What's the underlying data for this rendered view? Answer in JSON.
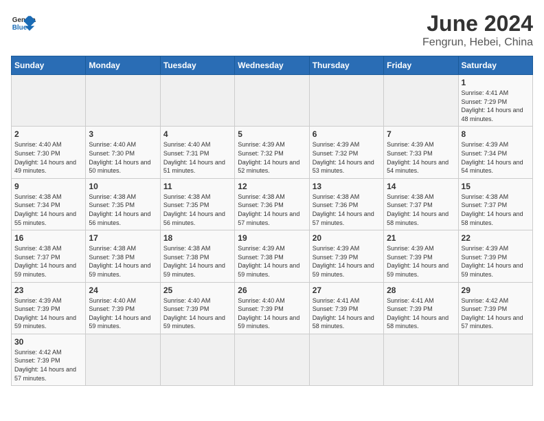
{
  "header": {
    "logo_general": "General",
    "logo_blue": "Blue",
    "month_title": "June 2024",
    "subtitle": "Fengrun, Hebei, China"
  },
  "weekdays": [
    "Sunday",
    "Monday",
    "Tuesday",
    "Wednesday",
    "Thursday",
    "Friday",
    "Saturday"
  ],
  "days": [
    {
      "day": "",
      "info": ""
    },
    {
      "day": "",
      "info": ""
    },
    {
      "day": "",
      "info": ""
    },
    {
      "day": "",
      "info": ""
    },
    {
      "day": "",
      "info": ""
    },
    {
      "day": "",
      "info": ""
    },
    {
      "day": "1",
      "sunrise": "Sunrise: 4:41 AM",
      "sunset": "Sunset: 7:29 PM",
      "daylight": "Daylight: 14 hours and 48 minutes."
    },
    {
      "day": "2",
      "sunrise": "Sunrise: 4:40 AM",
      "sunset": "Sunset: 7:30 PM",
      "daylight": "Daylight: 14 hours and 49 minutes."
    },
    {
      "day": "3",
      "sunrise": "Sunrise: 4:40 AM",
      "sunset": "Sunset: 7:30 PM",
      "daylight": "Daylight: 14 hours and 50 minutes."
    },
    {
      "day": "4",
      "sunrise": "Sunrise: 4:40 AM",
      "sunset": "Sunset: 7:31 PM",
      "daylight": "Daylight: 14 hours and 51 minutes."
    },
    {
      "day": "5",
      "sunrise": "Sunrise: 4:39 AM",
      "sunset": "Sunset: 7:32 PM",
      "daylight": "Daylight: 14 hours and 52 minutes."
    },
    {
      "day": "6",
      "sunrise": "Sunrise: 4:39 AM",
      "sunset": "Sunset: 7:32 PM",
      "daylight": "Daylight: 14 hours and 53 minutes."
    },
    {
      "day": "7",
      "sunrise": "Sunrise: 4:39 AM",
      "sunset": "Sunset: 7:33 PM",
      "daylight": "Daylight: 14 hours and 54 minutes."
    },
    {
      "day": "8",
      "sunrise": "Sunrise: 4:39 AM",
      "sunset": "Sunset: 7:34 PM",
      "daylight": "Daylight: 14 hours and 54 minutes."
    },
    {
      "day": "9",
      "sunrise": "Sunrise: 4:38 AM",
      "sunset": "Sunset: 7:34 PM",
      "daylight": "Daylight: 14 hours and 55 minutes."
    },
    {
      "day": "10",
      "sunrise": "Sunrise: 4:38 AM",
      "sunset": "Sunset: 7:35 PM",
      "daylight": "Daylight: 14 hours and 56 minutes."
    },
    {
      "day": "11",
      "sunrise": "Sunrise: 4:38 AM",
      "sunset": "Sunset: 7:35 PM",
      "daylight": "Daylight: 14 hours and 56 minutes."
    },
    {
      "day": "12",
      "sunrise": "Sunrise: 4:38 AM",
      "sunset": "Sunset: 7:36 PM",
      "daylight": "Daylight: 14 hours and 57 minutes."
    },
    {
      "day": "13",
      "sunrise": "Sunrise: 4:38 AM",
      "sunset": "Sunset: 7:36 PM",
      "daylight": "Daylight: 14 hours and 57 minutes."
    },
    {
      "day": "14",
      "sunrise": "Sunrise: 4:38 AM",
      "sunset": "Sunset: 7:37 PM",
      "daylight": "Daylight: 14 hours and 58 minutes."
    },
    {
      "day": "15",
      "sunrise": "Sunrise: 4:38 AM",
      "sunset": "Sunset: 7:37 PM",
      "daylight": "Daylight: 14 hours and 58 minutes."
    },
    {
      "day": "16",
      "sunrise": "Sunrise: 4:38 AM",
      "sunset": "Sunset: 7:37 PM",
      "daylight": "Daylight: 14 hours and 59 minutes."
    },
    {
      "day": "17",
      "sunrise": "Sunrise: 4:38 AM",
      "sunset": "Sunset: 7:38 PM",
      "daylight": "Daylight: 14 hours and 59 minutes."
    },
    {
      "day": "18",
      "sunrise": "Sunrise: 4:38 AM",
      "sunset": "Sunset: 7:38 PM",
      "daylight": "Daylight: 14 hours and 59 minutes."
    },
    {
      "day": "19",
      "sunrise": "Sunrise: 4:39 AM",
      "sunset": "Sunset: 7:38 PM",
      "daylight": "Daylight: 14 hours and 59 minutes."
    },
    {
      "day": "20",
      "sunrise": "Sunrise: 4:39 AM",
      "sunset": "Sunset: 7:39 PM",
      "daylight": "Daylight: 14 hours and 59 minutes."
    },
    {
      "day": "21",
      "sunrise": "Sunrise: 4:39 AM",
      "sunset": "Sunset: 7:39 PM",
      "daylight": "Daylight: 14 hours and 59 minutes."
    },
    {
      "day": "22",
      "sunrise": "Sunrise: 4:39 AM",
      "sunset": "Sunset: 7:39 PM",
      "daylight": "Daylight: 14 hours and 59 minutes."
    },
    {
      "day": "23",
      "sunrise": "Sunrise: 4:39 AM",
      "sunset": "Sunset: 7:39 PM",
      "daylight": "Daylight: 14 hours and 59 minutes."
    },
    {
      "day": "24",
      "sunrise": "Sunrise: 4:40 AM",
      "sunset": "Sunset: 7:39 PM",
      "daylight": "Daylight: 14 hours and 59 minutes."
    },
    {
      "day": "25",
      "sunrise": "Sunrise: 4:40 AM",
      "sunset": "Sunset: 7:39 PM",
      "daylight": "Daylight: 14 hours and 59 minutes."
    },
    {
      "day": "26",
      "sunrise": "Sunrise: 4:40 AM",
      "sunset": "Sunset: 7:39 PM",
      "daylight": "Daylight: 14 hours and 59 minutes."
    },
    {
      "day": "27",
      "sunrise": "Sunrise: 4:41 AM",
      "sunset": "Sunset: 7:39 PM",
      "daylight": "Daylight: 14 hours and 58 minutes."
    },
    {
      "day": "28",
      "sunrise": "Sunrise: 4:41 AM",
      "sunset": "Sunset: 7:39 PM",
      "daylight": "Daylight: 14 hours and 58 minutes."
    },
    {
      "day": "29",
      "sunrise": "Sunrise: 4:42 AM",
      "sunset": "Sunset: 7:39 PM",
      "daylight": "Daylight: 14 hours and 57 minutes."
    },
    {
      "day": "30",
      "sunrise": "Sunrise: 4:42 AM",
      "sunset": "Sunset: 7:39 PM",
      "daylight": "Daylight: 14 hours and 57 minutes."
    }
  ]
}
